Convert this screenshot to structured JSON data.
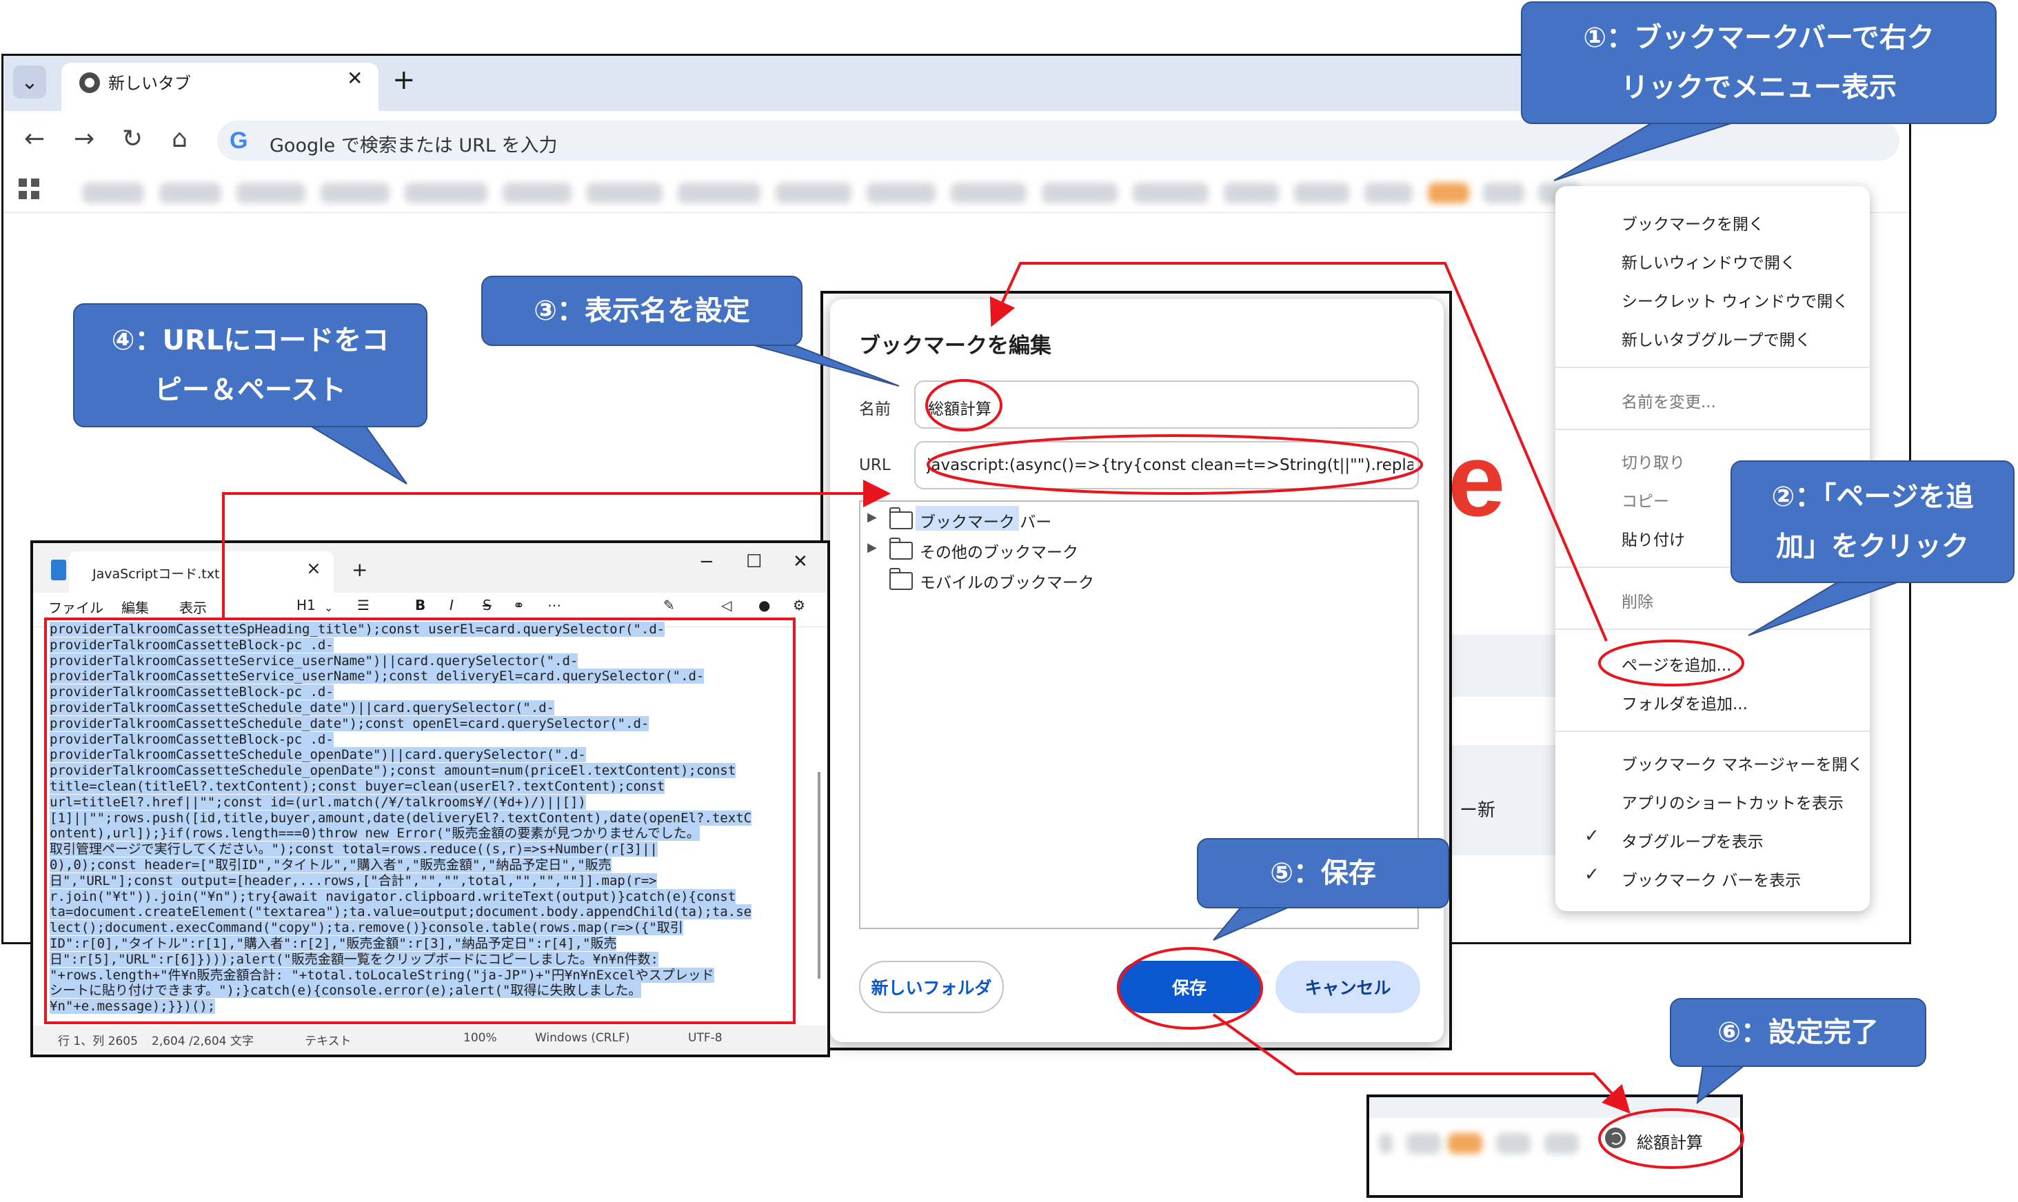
{
  "chrome": {
    "tab_title": "新しいタブ",
    "new_tab_symbol": "+",
    "tab_close_symbol": "✕",
    "omnibox_g": "G",
    "omnibox_placeholder": "Google で検索または URL を入力",
    "partial_text": "ー新"
  },
  "context_menu": {
    "items": [
      "ブックマークを開く",
      "新しいウィンドウで開く",
      "シークレット ウィンドウで開く",
      "新しいタブグループで開く",
      "名前を変更...",
      "切り取り",
      "コピー",
      "貼り付け",
      "削除",
      "ページを追加...",
      "フォルダを追加...",
      "ブックマーク マネージャーを開く",
      "アプリのショートカットを表示",
      "タブグループを表示",
      "ブックマーク バーを表示"
    ],
    "check_symbol": "✓"
  },
  "dialog": {
    "title": "ブックマークを編集",
    "name_label": "名前",
    "url_label": "URL",
    "name_value": "総額計算",
    "url_value": "javascript:(async()=>{try{const clean=t=>String(t||\"\").replace(/¥s+/",
    "folders": [
      "ブックマーク バー",
      "その他のブックマーク",
      "モバイルのブックマーク"
    ],
    "new_folder_button": "新しいフォルダ",
    "save_button": "保存",
    "cancel_button": "キャンセル"
  },
  "notepad": {
    "tab_title": "JavaScriptコード.txt",
    "menu": [
      "ファイル",
      "編集",
      "表示"
    ],
    "heading_select": "H1",
    "format_bold": "B",
    "format_italic": "I",
    "format_strike": "S",
    "lines": [
      "providerTalkroomCassetteSpHeading_title\");const userEl=card.querySelector(\".d-",
      "providerTalkroomCassetteBlock-pc .d-",
      "providerTalkroomCassetteService_userName\")||card.querySelector(\".d-",
      "providerTalkroomCassetteService_userName\");const deliveryEl=card.querySelector(\".d-",
      "providerTalkroomCassetteBlock-pc .d-",
      "providerTalkroomCassetteSchedule_date\")||card.querySelector(\".d-",
      "providerTalkroomCassetteSchedule_date\");const openEl=card.querySelector(\".d-",
      "providerTalkroomCassetteBlock-pc .d-",
      "providerTalkroomCassetteSchedule_openDate\")||card.querySelector(\".d-",
      "providerTalkroomCassetteSchedule_openDate\");const amount=num(priceEl.textContent);const",
      "title=clean(titleEl?.textContent);const buyer=clean(userEl?.textContent);const",
      "url=titleEl?.href||\"\";const id=(url.match(/¥/talkrooms¥/(¥d+)/)||[])",
      "[1]||\"\";rows.push([id,title,buyer,amount,date(deliveryEl?.textContent),date(openEl?.textC",
      "ontent),url]);}if(rows.length===0)throw new Error(\"販売金額の要素が見つかりませんでした。",
      "取引管理ページで実行してください。\");const total=rows.reduce((s,r)=>s+Number(r[3]||",
      "0),0);const header=[\"取引ID\",\"タイトル\",\"購入者\",\"販売金額\",\"納品予定日\",\"販売",
      "日\",\"URL\"];const output=[header,...rows,[\"合計\",\"\",\"\",total,\"\",\"\",\"\"]].map(r=>",
      "r.join(\"¥t\")).join(\"¥n\");try{await navigator.clipboard.writeText(output)}catch(e){const",
      "ta=document.createElement(\"textarea\");ta.value=output;document.body.appendChild(ta);ta.se",
      "lect();document.execCommand(\"copy\");ta.remove()}console.table(rows.map(r=>({\"取引",
      "ID\":r[0],\"タイトル\":r[1],\"購入者\":r[2],\"販売金額\":r[3],\"納品予定日\":r[4],\"販売",
      "日\":r[5],\"URL\":r[6]})));alert(\"販売金額一覧をクリップボードにコピーしました。¥n¥n件数:",
      "\"+rows.length+\"件¥n販売金額合計: \"+total.toLocaleString(\"ja-JP\")+\"円¥n¥nExcelやスプレッド",
      "シートに貼り付けできます。\");}catch(e){console.error(e);alert(\"取得に失敗しました。",
      "¥n\"+e.message);}})();"
    ],
    "status": [
      "行 1、列 2605",
      "2,604 /2,604 文字",
      "テキスト",
      "100%",
      "Windows (CRLF)",
      "UTF-8"
    ]
  },
  "result": {
    "bookmark_label": "総額計算"
  },
  "callouts": {
    "c1": [
      "①：ブックマークバーで右ク",
      "リックでメニュー表示"
    ],
    "c2": [
      "②：「ページを追",
      "加」をクリック"
    ],
    "c3": [
      "③：表示名を設定"
    ],
    "c4": [
      "④：URLにコードをコ",
      "ピー＆ペースト"
    ],
    "c5": [
      "⑤：保存"
    ],
    "c6": [
      "⑥：設定完了"
    ]
  },
  "colors": {
    "callout_fill": "#4472c4",
    "annotation_red": "#e8141e",
    "save_button": "#0b57d0",
    "selection": "#b7d3f5"
  },
  "icons": [
    "chevron-down-icon",
    "chrome-icon",
    "back-arrow-icon",
    "forward-arrow-icon",
    "reload-icon",
    "home-icon",
    "google-icon",
    "apps-grid-icon",
    "folder-icon",
    "notepad-icon",
    "globe-icon",
    "check-icon"
  ]
}
